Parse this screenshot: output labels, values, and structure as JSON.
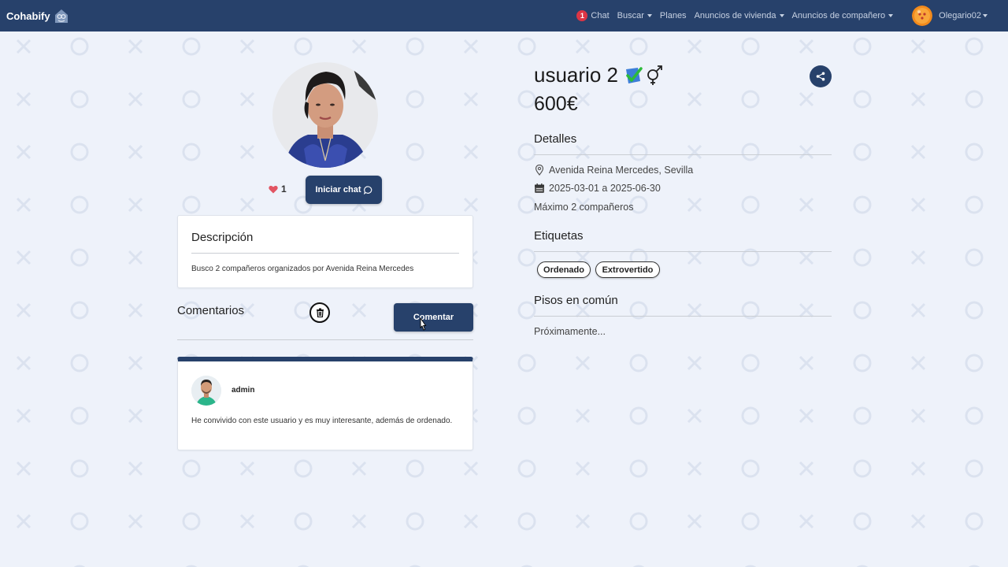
{
  "nav": {
    "brand": "Cohabify",
    "chat_count": "1",
    "chat_label": "Chat",
    "search_label": "Buscar",
    "plans_label": "Planes",
    "housing_label": "Anuncios de vivienda",
    "mates_label": "Anuncios de compañero",
    "username": "Olegario02"
  },
  "profile": {
    "likes": "1",
    "start_chat_label": "Iniciar chat",
    "name": "usuario 2",
    "price": "600€"
  },
  "description": {
    "title": "Descripción",
    "text": "Busco 2 compañeros organizados por Avenida Reina Mercedes"
  },
  "comments": {
    "title": "Comentarios",
    "comment_button": "Comentar",
    "items": [
      {
        "author": "admin",
        "text": "He convivido con este usuario y es muy interesante, además de ordenado."
      }
    ]
  },
  "details": {
    "title": "Detalles",
    "address": "Avenida Reina Mercedes, Sevilla",
    "dates": "2025-03-01 a 2025-06-30",
    "max_mates": "Máximo 2 compañeros"
  },
  "tags": {
    "title": "Etiquetas",
    "items": [
      "Ordenado",
      "Extrovertido"
    ]
  },
  "shared_flats": {
    "title": "Pisos en común",
    "text": "Próximamente..."
  },
  "colors": {
    "primary": "#27416b",
    "background": "#eef2fa",
    "badge": "#dc3545",
    "heart": "#e25563"
  },
  "icons": [
    "logo-icon",
    "caret-icon",
    "heart-icon",
    "chat-bubble-icon",
    "trash-icon",
    "share-icon",
    "verified-icon",
    "gender-icon",
    "location-pin-icon",
    "calendar-icon"
  ]
}
